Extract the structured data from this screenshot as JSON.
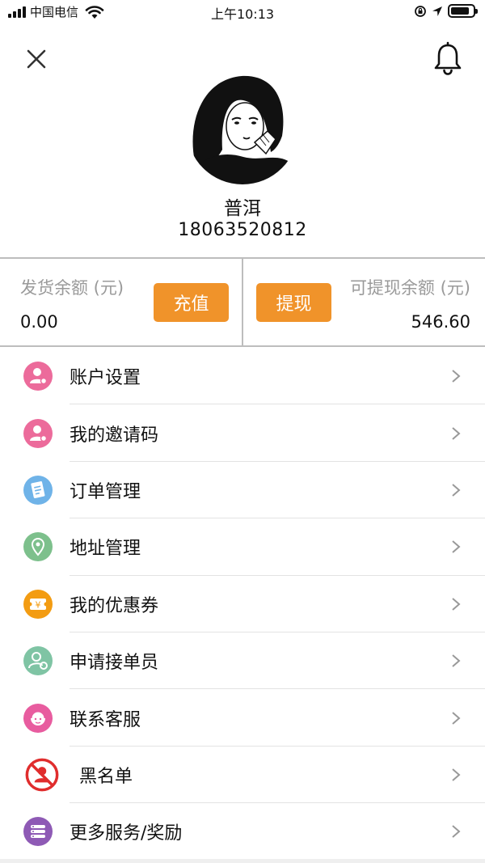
{
  "status_bar": {
    "carrier": "中国电信",
    "time": "上午10:13"
  },
  "header": {
    "close_icon": "close-icon",
    "bell_icon": "bell-icon"
  },
  "profile": {
    "name": "普洱",
    "phone": "18063520812"
  },
  "balance": {
    "shipping_label": "发货余额 (元)",
    "shipping_value": "0.00",
    "recharge_label": "充值",
    "withdraw_label": "提现",
    "withdrawable_label": "可提现余额 (元)",
    "withdrawable_value": "546.60",
    "button_color": "#f0932a"
  },
  "menu": {
    "items": [
      {
        "label": "账户设置",
        "icon": "account-settings-icon",
        "color": "#ec6b9b"
      },
      {
        "label": "我的邀请码",
        "icon": "invite-code-icon",
        "color": "#ec6b9b"
      },
      {
        "label": "订单管理",
        "icon": "order-icon",
        "color": "#6fb3e8"
      },
      {
        "label": "地址管理",
        "icon": "location-icon",
        "color": "#7dc08c"
      },
      {
        "label": "我的优惠券",
        "icon": "coupon-icon",
        "color": "#f39c12"
      },
      {
        "label": "申请接单员",
        "icon": "apply-courier-icon",
        "color": "#7fc4a4"
      },
      {
        "label": "联系客服",
        "icon": "customer-service-icon",
        "color": "#e85c9f"
      },
      {
        "label": "黑名单",
        "icon": "blacklist-icon",
        "color": "#e02d2d"
      },
      {
        "label": "更多服务/奖励",
        "icon": "more-services-icon",
        "color": "#8e5ab5"
      }
    ]
  }
}
